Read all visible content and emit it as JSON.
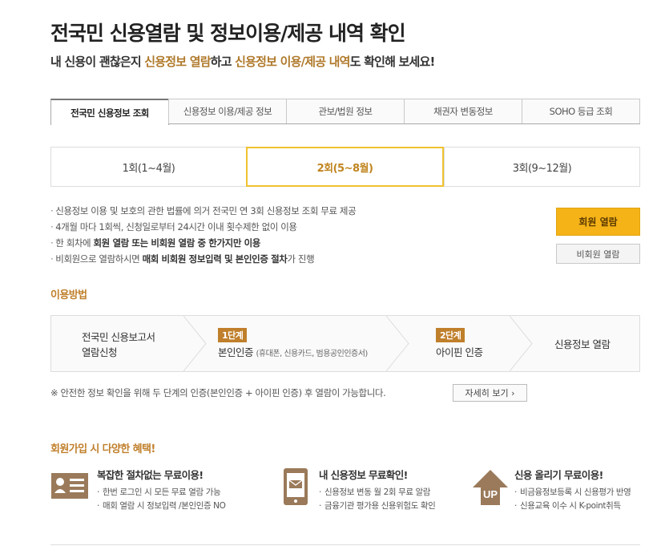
{
  "header": {
    "title": "전국민 신용열람 및 정보이용/제공 내역 확인",
    "subtitle_parts": [
      "내 신용이 괜찮은지 ",
      "신용정보 열람",
      "하고 ",
      "신용정보 이용/제공 내역",
      "도 확인해 보세요!"
    ]
  },
  "tabs": [
    {
      "label": "전국민 신용정보 조회",
      "active": true
    },
    {
      "label": "신용정보 이용/제공 정보"
    },
    {
      "label": "관보/법원 정보"
    },
    {
      "label": "채권자 변동정보"
    },
    {
      "label": "SOHO 등급 조회"
    }
  ],
  "rounds": [
    {
      "label": "1회(1~4월)"
    },
    {
      "label": "2회(5~8월)",
      "active": true
    },
    {
      "label": "3회(9~12월)"
    }
  ],
  "notes": {
    "n1": "신용정보 이용 및 보호의 관한 법률에 의거 전국민 연 3회 신용정보 조회 무료 제공",
    "n2": "4개월 마다 1회씩, 신청일로부터 24시간 이내 횟수제한 없이 이용",
    "n3_a": "한 회차에 ",
    "n3_b": "회원 열람 또는 비회원 열람 중 한가지만 이용",
    "n4_a": "비회원으로 열람하시면 ",
    "n4_b": "매회 비회원 정보입력 및 본인인증 절차",
    "n4_c": "가 진행"
  },
  "buttons": {
    "member": "회원 열람",
    "nonmember": "비회원 열람",
    "detail": "자세히 보기 ›"
  },
  "usage": {
    "title": "이용방법",
    "step0_line1": "전국민 신용보고서",
    "step0_line2": "열람신청",
    "step1_badge": "1단계",
    "step1_main": "본인인증",
    "step1_small": "(휴대폰, 신용카드, 범용공인인증서)",
    "step2_badge": "2단계",
    "step2_main": "아이핀 인증",
    "step3": "신용정보 열람",
    "secure_note": "※ 안전한 정보 확인을 위해 두 단계의 인증(본인인증 + 아이핀 인증) 후 열람이 가능합니다."
  },
  "benefits": {
    "title": "회원가입 시 다양한 혜택!",
    "items": [
      {
        "title": "복잡한 절차없는 무료이용!",
        "lines": [
          "한번 로그인 시 모든 무료 열람 가능",
          "매회 열람 시 정보입력 /본인인증 NO"
        ]
      },
      {
        "title": "내 신용정보 무료확인!",
        "lines": [
          "신용정보 변동 월 2회 무료 알람",
          "금융기관 평가용 신용위험도 확인"
        ]
      },
      {
        "title": "신용 올리기 무료이용!",
        "lines": [
          "비금융정보등록 시 신용평가 반영",
          "신용교육 이수 시 K-point취득"
        ]
      }
    ],
    "up_icon_text": "UP"
  },
  "colors": {
    "accent": "#c07f2b",
    "member_button": "#f5b318",
    "round_highlight": "#f0c230"
  }
}
